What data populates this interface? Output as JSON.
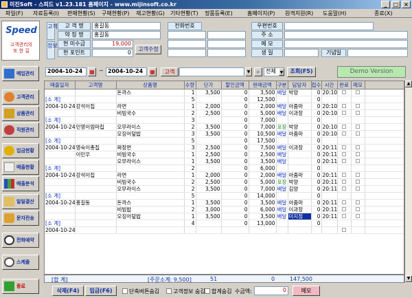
{
  "window": {
    "title": "미진Soft - 스피드 v1.23.181 홈페이지 - www.mijinsoft.co.kr",
    "min": "_",
    "max": "□",
    "close": "×"
  },
  "menu": [
    "파일(F)",
    "자료등록(I)",
    "판매현황(S)",
    "구매현황(P)",
    "재고현황(G)",
    "기타현황(T)",
    "정품등록(E)",
    "홈페이지(P)",
    "원격지원(R)",
    "도움말(H)",
    "종료(X)"
  ],
  "logo": {
    "title": "Speed",
    "sub1": "고객관리의",
    "sub2": "또 한 길"
  },
  "nav": [
    "매입관리",
    "고객관리",
    "상품관리",
    "직원관리",
    "입금현황",
    "매출현황",
    "매출분석",
    "일일결산",
    "문자전송",
    "전화예약",
    "스케줄",
    "종료"
  ],
  "customer": {
    "side1": "고객",
    "side2": "정보",
    "name_label": "고 객 명",
    "name_value": "홍길동",
    "alias_label": "약 칭 명",
    "alias_value": "홍길동",
    "unpaid_label": "현 미수금",
    "unpaid_value": "19,000",
    "point_label": "현 포인트",
    "point_value": "0",
    "modify_button": "고객수정",
    "phone_label": "전화번호",
    "zip_label": "우편번호",
    "addr_label": "주  소",
    "memo_label": "메  모",
    "birth_label": "생  일",
    "anniv_label": "기념일"
  },
  "filter": {
    "date_from": "2004-10-24",
    "date_to": "2004-10-24",
    "cust_button": "고객",
    "range_select": "전체",
    "search_button": "조회(F5)",
    "demo": "Demo Version"
  },
  "grid": {
    "headers": [
      "매출일자",
      "고객명",
      "상품명",
      "수량",
      "단가",
      "할인금액",
      "판매금액",
      "구분",
      "담당자",
      "접수",
      "시간",
      "완료",
      "메모"
    ],
    "rows": [
      [
        "",
        "",
        "돈까스",
        "1",
        "3,500",
        "0",
        "3,500",
        "배달",
        "박양",
        "0",
        "20:10",
        "",
        ""
      ],
      [
        "[소 계]",
        "",
        "",
        "5",
        "",
        "0",
        "12,500",
        "",
        "",
        "0",
        "",
        "",
        ""
      ],
      [
        "2004-10-24",
        "강석이집",
        "라면",
        "1",
        "2,000",
        "0",
        "2,000",
        "배달",
        "아줌마",
        "0",
        "20:10",
        "",
        ""
      ],
      [
        "",
        "",
        "비빔국수",
        "2",
        "2,500",
        "0",
        "5,000",
        "배달",
        "이과장",
        "0",
        "20:10",
        "",
        ""
      ],
      [
        "[소 계]",
        "",
        "",
        "3",
        "",
        "0",
        "7,000",
        "",
        "",
        "0",
        "",
        "",
        ""
      ],
      [
        "2004-10-24",
        "민영이엄마집",
        "오무라이스",
        "2",
        "3,500",
        "0",
        "7,000",
        "포장",
        "박양",
        "0",
        "20:10",
        "",
        ""
      ],
      [
        "",
        "",
        "오징어덮밥",
        "3",
        "3,500",
        "0",
        "10,500",
        "배달",
        "아줌마",
        "0",
        "20:10",
        "",
        ""
      ],
      [
        "[소 계]",
        "",
        "",
        "5",
        "",
        "0",
        "17,500",
        "",
        "",
        "0",
        "",
        "",
        ""
      ],
      [
        "2004-10-24",
        "영숙이총집",
        "짜장면",
        "3",
        "2,500",
        "0",
        "7,500",
        "배달",
        "이과장",
        "0",
        "20:11",
        "",
        ""
      ],
      [
        "",
        "이민우",
        "비빔국수",
        "1",
        "2,500",
        "0",
        "2,500",
        "배달",
        "",
        "0",
        "20:11",
        "",
        ""
      ],
      [
        "",
        "",
        "오무라이스",
        "1",
        "3,500",
        "0",
        "3,500",
        "배달",
        "",
        "0",
        "20:11",
        "",
        ""
      ],
      [
        "[소 계]",
        "",
        "",
        "2",
        "",
        "0",
        "6,000",
        "",
        "",
        "0",
        "",
        "",
        ""
      ],
      [
        "2004-10-24",
        "강석이집",
        "라면",
        "1",
        "2,000",
        "0",
        "2,000",
        "배달",
        "아줌마",
        "0",
        "20:11",
        "",
        ""
      ],
      [
        "",
        "",
        "비빔국수",
        "2",
        "2,500",
        "0",
        "5,000",
        "포장",
        "박양",
        "0",
        "20:11",
        "",
        ""
      ],
      [
        "",
        "",
        "오무라이스",
        "2",
        "3,500",
        "0",
        "7,000",
        "배달",
        "김양",
        "0",
        "20:11",
        "",
        ""
      ],
      [
        "[소 계]",
        "",
        "",
        "5",
        "",
        "0",
        "14,000",
        "",
        "",
        "0",
        "",
        "",
        ""
      ],
      [
        "2004-10-24",
        "홍길동",
        "돈까스",
        "1",
        "3,500",
        "0",
        "3,500",
        "배달",
        "아줌마",
        "0",
        "20:11",
        "",
        ""
      ],
      [
        "",
        "",
        "비빔밥",
        "2",
        "3,000",
        "0",
        "6,000",
        "배달",
        "이과장",
        "0",
        "20:11",
        "",
        ""
      ],
      [
        "",
        "",
        "오징어덮밥",
        "1",
        "3,500",
        "0",
        "3,500",
        "배달",
        "미지정",
        "0",
        "20:11",
        "",
        ""
      ],
      [
        "[소 계]",
        "",
        "",
        "4",
        "",
        "0",
        "13,000",
        "",
        "",
        "0",
        "",
        "",
        ""
      ],
      [
        "2004-10-24",
        "",
        "",
        "",
        "",
        "",
        "",
        "",
        "",
        "",
        "",
        "",
        ""
      ]
    ]
  },
  "summary": {
    "label": "[합 계]",
    "note": "[주문소계: 9,500]",
    "qty": "51",
    "disc": "0",
    "amount": "147,500"
  },
  "bottom": {
    "delete": "삭제(F4)",
    "payin": "입금(F6)",
    "opt1": "단축버튼숨김",
    "opt2": "고객정보 숨김",
    "opt3": "합계숨김",
    "receipt_label": "수금액:",
    "receipt_value": "0",
    "memo_button": "메모"
  }
}
